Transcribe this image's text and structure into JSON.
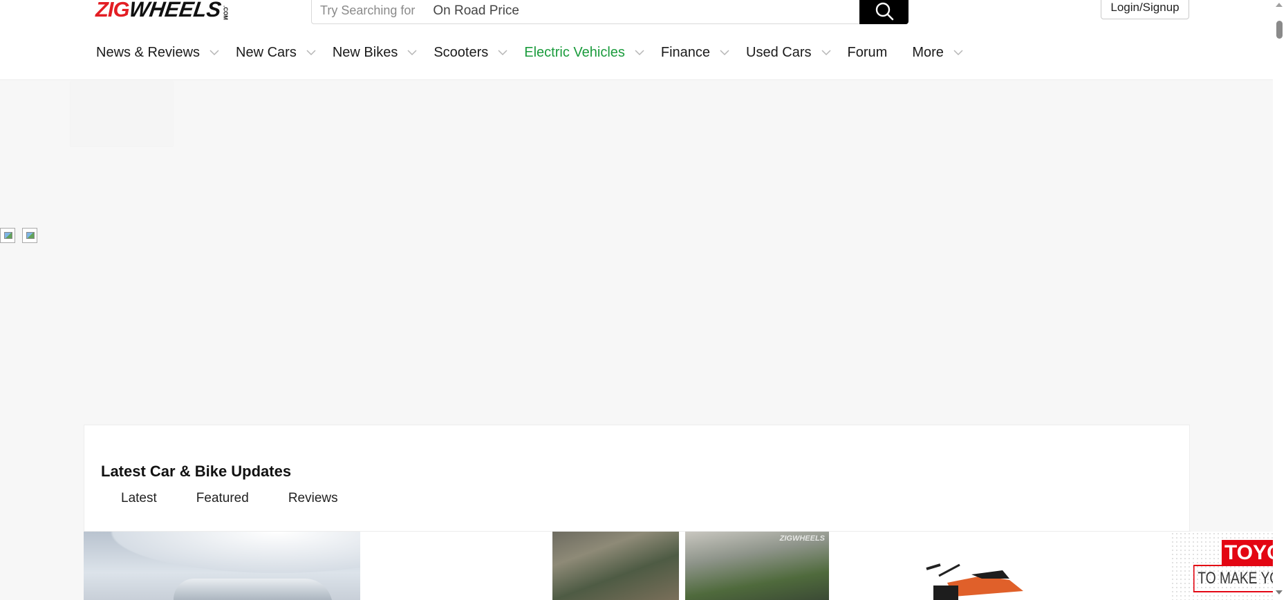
{
  "header": {
    "logo": {
      "red": "ZIG",
      "black": "WHEELS",
      "suffix": ".COM"
    },
    "search": {
      "hint": "Try Searching for",
      "rotating": "On Road Price",
      "icon": "search-icon"
    },
    "login_label": "Login/Signup"
  },
  "nav": {
    "items": [
      {
        "label": "News & Reviews",
        "dropdown": true
      },
      {
        "label": "New Cars",
        "dropdown": true
      },
      {
        "label": "New Bikes",
        "dropdown": true
      },
      {
        "label": "Scooters",
        "dropdown": true
      },
      {
        "label": "Electric Vehicles",
        "dropdown": true,
        "active": true
      },
      {
        "label": "Finance",
        "dropdown": true
      },
      {
        "label": "Used Cars",
        "dropdown": true
      },
      {
        "label": "Forum",
        "dropdown": false
      },
      {
        "label": "More",
        "dropdown": true
      }
    ],
    "active_color": "#1a9b3c"
  },
  "updates": {
    "title": "Latest Car & Bike Updates",
    "tabs": [
      "Latest",
      "Featured",
      "Reviews"
    ],
    "thumbnails": {
      "watermark": "ZIGWHEELS",
      "ad_text_1": "TOYO",
      "ad_text_2": "TO MAKE YOU"
    }
  },
  "colors": {
    "brand_red": "#e31e24",
    "accent_green": "#1a9b3c"
  }
}
